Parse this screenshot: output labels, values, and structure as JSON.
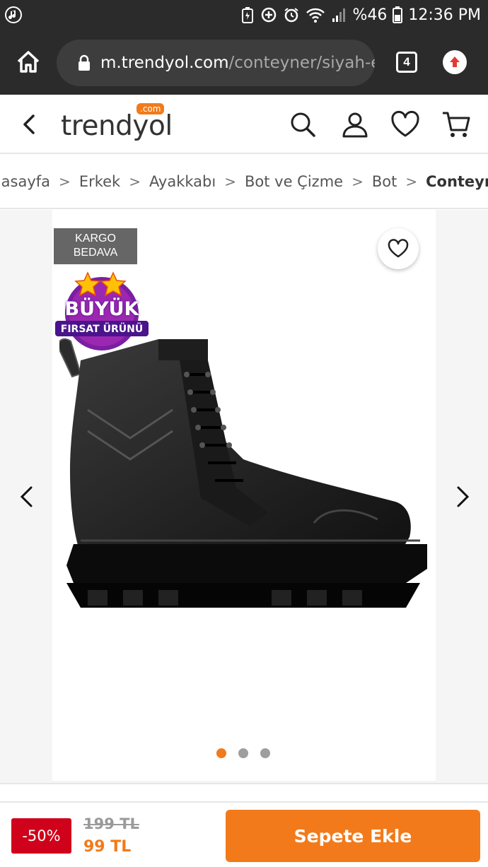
{
  "status_bar": {
    "battery_percent": "%46",
    "time": "12:36 PM",
    "icons": [
      "music-icon",
      "battery-saver-icon",
      "data-saver-icon",
      "alarm-icon",
      "wifi-icon",
      "signal-icon",
      "battery-icon"
    ]
  },
  "browser": {
    "url_host": "m.trendyol.com",
    "url_path": "/conteyner/siyah-e",
    "tab_count": "4"
  },
  "header": {
    "logo_text": "trendyol",
    "logo_sup": ".com"
  },
  "breadcrumb": {
    "items": [
      "Anasayfa",
      "Erkek",
      "Ayakkabı",
      "Bot ve Çizme",
      "Bot",
      "Conteyner Bot"
    ]
  },
  "product": {
    "badge_line1": "KARGO",
    "badge_line2": "BEDAVA",
    "opportunity_line1": "BÜYÜK",
    "opportunity_line2": "FIRSAT ÜRÜNÜ",
    "image_count": 3,
    "active_image": 1
  },
  "purchase": {
    "discount": "-50%",
    "old_price": "199 TL",
    "new_price": "99 TL",
    "add_to_cart": "Sepete Ekle"
  },
  "colors": {
    "brand_orange": "#f27a1a",
    "discount_red": "#d0011b",
    "browser_dark": "#2b2b2b"
  }
}
